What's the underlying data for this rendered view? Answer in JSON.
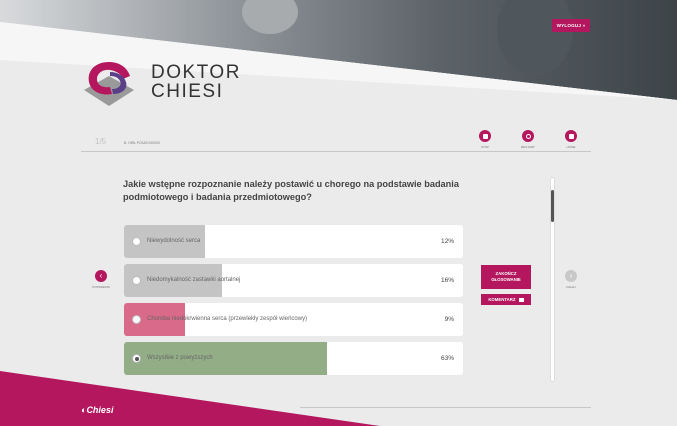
{
  "header": {
    "logout_label": "WYLOGUJ »",
    "brand_line1": "DOKTOR",
    "brand_line2": "CHIESI"
  },
  "toolbar": {
    "page_number": "1/5",
    "meta_text": "B. I NRL PCSAS 000XXX",
    "tools": [
      {
        "label": "STOP",
        "icon": "stop-icon"
      },
      {
        "label": "RESTART",
        "icon": "restart-icon"
      },
      {
        "label": "HOME",
        "icon": "home-icon"
      }
    ]
  },
  "question": "Jakie wstępne rozpoznanie należy postawić u chorego na podstawie badania podmiotowego i badania przedmiotowego?",
  "answers": [
    {
      "text": "Niewydolność serca",
      "percent": "12%",
      "fraction": 0.24,
      "bar_color": "#c4c4c4",
      "selected": false
    },
    {
      "text": "Niedomykalność zastawki aortalnej",
      "percent": "16%",
      "fraction": 0.29,
      "bar_color": "#c4c4c4",
      "selected": false
    },
    {
      "text": "Choroba niedokrwienna serca (przewlekły zespół wieńcowy)",
      "percent": "9%",
      "fraction": 0.18,
      "bar_color": "#d96a8a",
      "selected": false
    },
    {
      "text": "Wszystkie z powyższych",
      "percent": "63%",
      "fraction": 0.6,
      "bar_color": "#93ad87",
      "selected": true
    }
  ],
  "nav": {
    "prev_label": "POPRZEDNI",
    "next_label": "DALEJ"
  },
  "buttons": {
    "end_vote_line1": "ZAKOŃCZ",
    "end_vote_line2": "GŁOSOWANIE",
    "comment_label": "KOMENTARZ"
  },
  "footer": {
    "logo_text": "Chiesi"
  },
  "colors": {
    "accent": "#b5175f"
  }
}
